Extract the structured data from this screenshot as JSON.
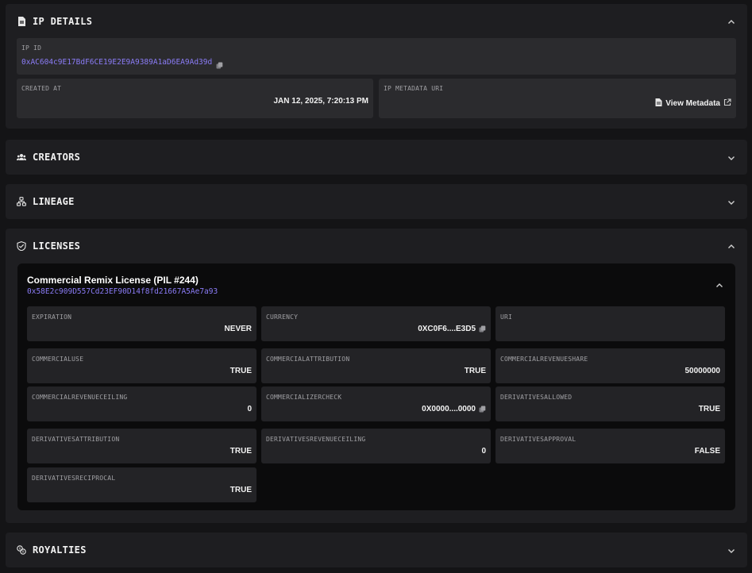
{
  "ip_details": {
    "title": "IP DETAILS",
    "ip_id_label": "IP ID",
    "ip_id_value": "0xAC604c9E17BdF6CE19E2E9A9389A1aD6EA9Ad39d",
    "created_at_label": "CREATED AT",
    "created_at_value": "JAN 12, 2025, 7:20:13 PM",
    "metadata_uri_label": "IP METADATA URI",
    "view_metadata_label": "View Metadata"
  },
  "creators": {
    "title": "CREATORS"
  },
  "lineage": {
    "title": "LINEAGE"
  },
  "licenses": {
    "title": "LICENSES",
    "license_title": "Commercial Remix License (PIL #244)",
    "license_address": "0x58E2c909D557Cd23EF90D14f8fd21667A5Ae7a93",
    "fields": [
      {
        "label": "EXPIRATION",
        "value": "NEVER"
      },
      {
        "label": "CURRENCY",
        "value": "0XC0F6....E3D5",
        "copy": true
      },
      {
        "label": "URI",
        "value": ""
      },
      {
        "label": "COMMERCIALUSE",
        "value": "TRUE"
      },
      {
        "label": "COMMERCIALATTRIBUTION",
        "value": "TRUE"
      },
      {
        "label": "COMMERCIALREVENUESHARE",
        "value": "50000000"
      },
      {
        "label": "COMMERCIALREVENUECEILING",
        "value": "0"
      },
      {
        "label": "COMMERCIALIZERCHECK",
        "value": "0X0000....0000",
        "copy": true
      },
      {
        "label": "DERIVATIVESALLOWED",
        "value": "TRUE"
      },
      {
        "label": "DERIVATIVESATTRIBUTION",
        "value": "TRUE"
      },
      {
        "label": "DERIVATIVESREVENUECEILING",
        "value": "0"
      },
      {
        "label": "DERIVATIVESAPPROVAL",
        "value": "FALSE"
      },
      {
        "label": "DERIVATIVESRECIPROCAL",
        "value": "TRUE"
      }
    ]
  },
  "royalties": {
    "title": "ROYALTIES"
  },
  "icons": {
    "ip_details": "document-icon",
    "creators": "users-icon",
    "lineage": "tree-icon",
    "licenses": "shield-handshake-icon",
    "royalties": "coins-icon",
    "copy": "copy-icon",
    "external": "external-link-icon"
  },
  "colors": {
    "accent": "#8b7cf7",
    "panel": "#1e1e21",
    "background": "#141416"
  }
}
